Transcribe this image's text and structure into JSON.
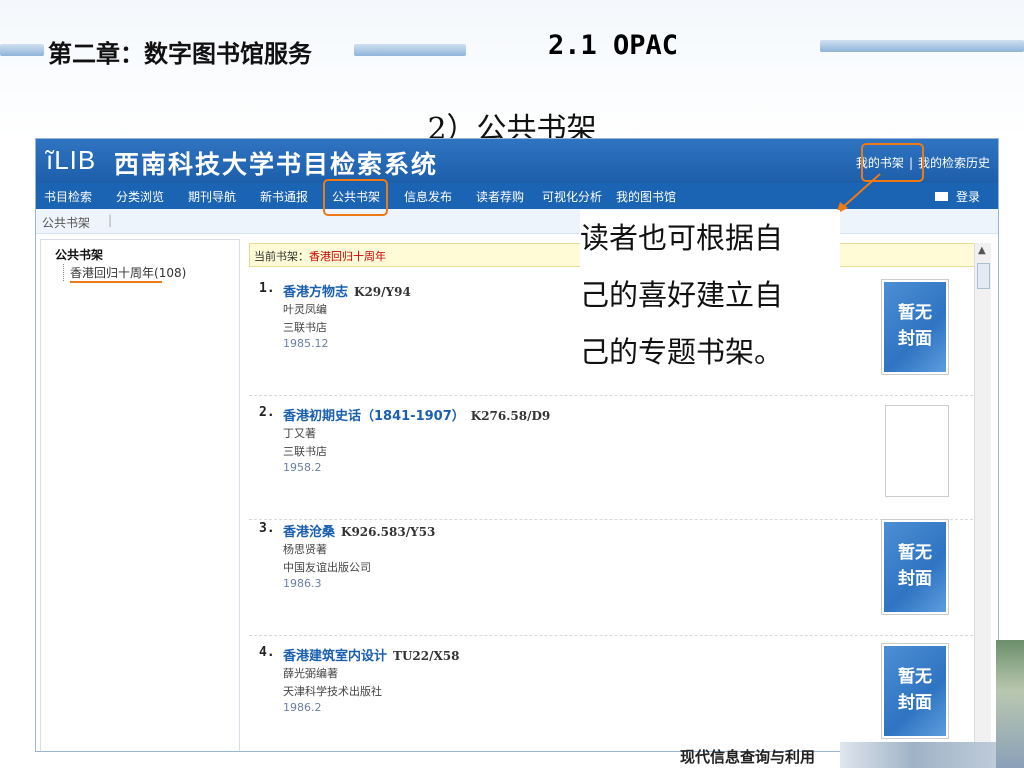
{
  "slide": {
    "chapter_title": "第二章：数字图书馆服务",
    "section_title": "2.1  OPAC",
    "subsection_title": "2）公共书架",
    "footer": "现代信息查询与利用"
  },
  "app": {
    "logo": "ĩLIB",
    "system_title": "西南科技大学书目检索系统",
    "top_links": [
      "我的书架",
      "我的检索历史"
    ],
    "nav": [
      "书目检索",
      "分类浏览",
      "期刊导航",
      "新书通报",
      "公共书架",
      "信息发布",
      "读者荐购",
      "可视化分析",
      "我的图书馆"
    ],
    "login": "登录",
    "breadcrumb": "公共书架",
    "sidebar": {
      "title": "公共书架",
      "items": [
        {
          "label": "香港回归十周年",
          "count": "(108)"
        }
      ]
    },
    "current_shelf": {
      "label": "当前书架：",
      "value": "香港回归十周年"
    },
    "cover_placeholder_line1": "暂无",
    "cover_placeholder_line2": "封面",
    "records": [
      {
        "num": "1.",
        "title": "香港方物志",
        "call": "K29/Y94",
        "author": "叶灵凤编",
        "publisher": "三联书店",
        "date": "1985.12",
        "has_placeholder": true
      },
      {
        "num": "2.",
        "title": "香港初期史话（1841-1907）",
        "call": "K276.58/D9",
        "author": "丁又著",
        "publisher": "三联书店",
        "date": "1958.2",
        "has_placeholder": false
      },
      {
        "num": "3.",
        "title": "香港沧桑",
        "call": "K926.583/Y53",
        "author": "杨思贤著",
        "publisher": "中国友谊出版公司",
        "date": "1986.3",
        "has_placeholder": true
      },
      {
        "num": "4.",
        "title": "香港建筑室内设计",
        "call": "TU22/X58",
        "author": "薛光弼编著",
        "publisher": "天津科学技术出版社",
        "date": "1986.2",
        "has_placeholder": true
      }
    ]
  },
  "annotation": {
    "callout_lines": [
      "读者也可根据自",
      "己的喜好建立自",
      "己的专题书架。"
    ],
    "color": "#ee7a16"
  }
}
